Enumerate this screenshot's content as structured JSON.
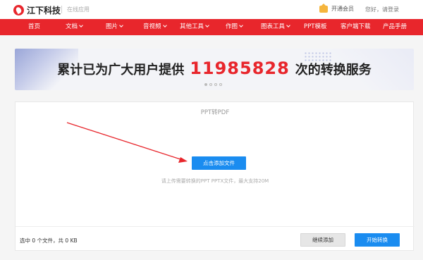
{
  "header": {
    "brand": "江下科技",
    "subtitle": "在线应用",
    "vip_label": "开通会员",
    "login_text": "您好，请登录"
  },
  "nav": {
    "items": [
      {
        "label": "首页",
        "has_dropdown": false
      },
      {
        "label": "文档",
        "has_dropdown": true
      },
      {
        "label": "图片",
        "has_dropdown": true
      },
      {
        "label": "音视频",
        "has_dropdown": true
      },
      {
        "label": "其他工具",
        "has_dropdown": true
      },
      {
        "label": "作图",
        "has_dropdown": true
      },
      {
        "label": "图表工具",
        "has_dropdown": true
      },
      {
        "label": "PPT模板",
        "has_dropdown": false
      },
      {
        "label": "客户端下载",
        "has_dropdown": false
      },
      {
        "label": "产品手册",
        "has_dropdown": false
      }
    ]
  },
  "banner": {
    "text_before": "累计已为广大用户提供",
    "count": "11985828",
    "text_after": "次的转换服务",
    "slide_count": 4,
    "active_slide": 1
  },
  "converter": {
    "title": "PPT转PDF",
    "add_button": "点击添加文件",
    "hint": "请上传需要转换的PPT PPTX文件，最大支持20M",
    "summary": "选中 0 个文件，共 0 KB",
    "continue_button": "继续添加",
    "start_button": "开始转换"
  },
  "colors": {
    "brand_red": "#e8262c",
    "primary_blue": "#1a8cf0"
  }
}
